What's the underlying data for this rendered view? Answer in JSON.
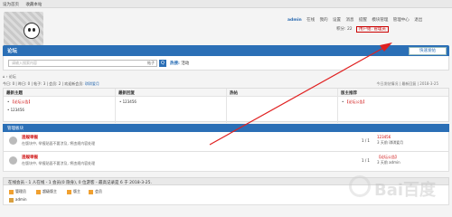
{
  "topbar": {
    "links": [
      "设为首页",
      "收藏本站"
    ]
  },
  "user": {
    "name": "admin",
    "items": [
      "在线",
      "我的",
      "设置",
      "消息",
      "提醒",
      "模块管理",
      "管理中心",
      "退出"
    ],
    "credit": "积分: 22",
    "group": "用户组: 管理员"
  },
  "nav": {
    "title": "论坛",
    "post_button": "快速发帖"
  },
  "search": {
    "placeholder": "请输入搜索内容",
    "scope": "帖子",
    "button": "Q",
    "hot_label": "热搜:",
    "hot_item": "活动"
  },
  "breadcrumb": {
    "path": "论坛"
  },
  "stats": {
    "text": "今日: 0 | 昨日: 0 | 帖子: 3 | 会员: 2 | 欢迎新会员:",
    "new_member": "琪琪爱月",
    "right": "今日发帖情况 | 最新回复 | 2018-3-25"
  },
  "table": {
    "cols": [
      {
        "head": "最新主题",
        "items": [
          "【论坛公告】",
          "123456"
        ]
      },
      {
        "head": "最新回复",
        "items": [
          "123456"
        ]
      },
      {
        "head": "热帖",
        "items": []
      },
      {
        "head": "版主推荐",
        "items": [
          "【论坛公告】"
        ]
      }
    ]
  },
  "section": {
    "title": "管理板块",
    "forums": [
      {
        "name": "违规举报",
        "desc": "在版块中, 举报贴面不要涉及, 将违规内容处理",
        "count": "1 / 1",
        "last_title": "123456",
        "last_meta": "3 天前 琪琪爱月"
      },
      {
        "name": "违规举报",
        "desc": "在版块中, 举报贴面不要涉及, 将违规内容处理",
        "count": "1 / 1",
        "last_title": "【论坛公告】",
        "last_meta": "3 天前 admin"
      }
    ]
  },
  "online": {
    "text": "在线会员 - 1 人在线 - 1 会员(0 隐身), 0 位游客 - 最高记录是 6 于 2018-3-25."
  },
  "legend": {
    "items": [
      "管理员",
      "超级版主",
      "版主",
      "会员"
    ],
    "admin": "admin"
  },
  "watermark": {
    "text": "Bai百度"
  },
  "colors": {
    "primary": "#2b6fb6",
    "accent": "#c00000",
    "arrow": "#e02020"
  }
}
